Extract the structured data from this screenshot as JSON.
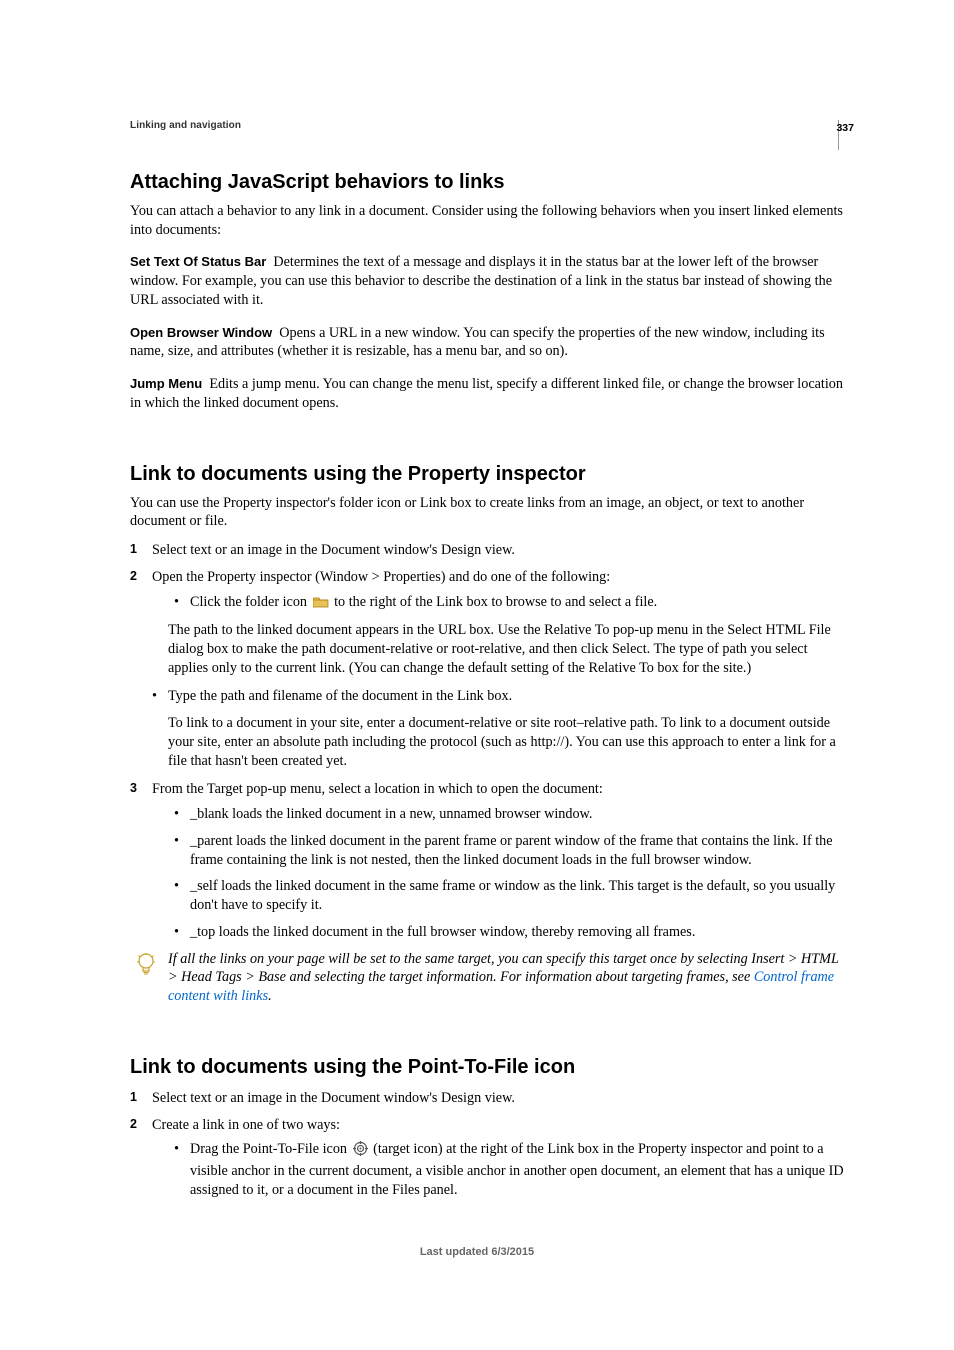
{
  "page_number": "337",
  "running_header": "Linking and navigation",
  "sections": {
    "attach": {
      "title": "Attaching JavaScript behaviors to links",
      "intro": "You can attach a behavior to any link in a document. Consider using the following behaviors when you insert linked elements into documents:",
      "defs": [
        {
          "term": "Set Text Of Status Bar",
          "body": "Determines the text of a message and displays it in the status bar at the lower left of the browser window. For example, you can use this behavior to describe the destination of a link in the status bar instead of showing the URL associated with it."
        },
        {
          "term": "Open Browser Window",
          "body": "Opens a URL in a new window. You can specify the properties of the new window, including its name, size, and attributes (whether it is resizable, has a menu bar, and so on)."
        },
        {
          "term": "Jump Menu",
          "body": "Edits a jump menu. You can change the menu list, specify a different linked file, or change the browser location in which the linked document opens."
        }
      ]
    },
    "prop": {
      "title": "Link to documents using the Property inspector",
      "intro": "You can use the Property inspector's folder icon or Link box to create links from an image, an object, or text to another document or file.",
      "step1": "Select text or an image in the Document window's Design view.",
      "step2": "Open the Property inspector (Window > Properties) and do one of the following:",
      "step2_b1_a": "Click the folder icon ",
      "step2_b1_b": " to the right of the Link box to browse to and select a file.",
      "step2_b1_p": "The path to the linked document appears in the URL box. Use the Relative To pop-up menu in the Select HTML File dialog box to make the path document-relative or root-relative, and then click Select. The type of path you select applies only to the current link. (You can change the default setting of the Relative To box for the site.)",
      "step2_b2": "Type the path and filename of the document in the Link box.",
      "step2_b2_p": "To link to a document in your site, enter a document-relative or site root–relative path. To link to a document outside your site, enter an absolute path including the protocol (such as http://). You can use this approach to enter a link for a file that hasn't been created yet.",
      "step3": "From the Target pop-up menu, select a location in which to open the document:",
      "step3_b1": "_blank loads the linked document in a new, unnamed browser window.",
      "step3_b2": "_parent loads the linked document in the parent frame or parent window of the frame that contains the link. If the frame containing the link is not nested, then the linked document loads in the full browser window.",
      "step3_b3": "_self loads the linked document in the same frame or window as the link. This target is the default, so you usually don't have to specify it.",
      "step3_b4": "_top loads the linked document in the full browser window, thereby removing all frames.",
      "tip_a": "If all the links on your page will be set to the same target, you can specify this target once by selecting Insert > HTML > Head Tags > Base and selecting the target information. For information about targeting frames, see ",
      "tip_link": "Control frame content with links",
      "tip_b": "."
    },
    "ptf": {
      "title": "Link to documents using the Point-To-File icon",
      "step1": "Select text or an image in the Document window's Design view.",
      "step2": "Create a link in one of two ways:",
      "step2_b1_a": "Drag the Point-To-File icon ",
      "step2_b1_b": " (target icon) at the right of the Link box in the Property inspector and point to a visible anchor in the current document, a visible anchor in another open document, an element that has a unique ID assigned to it, or a document in the Files panel."
    }
  },
  "footer": "Last updated 6/3/2015"
}
